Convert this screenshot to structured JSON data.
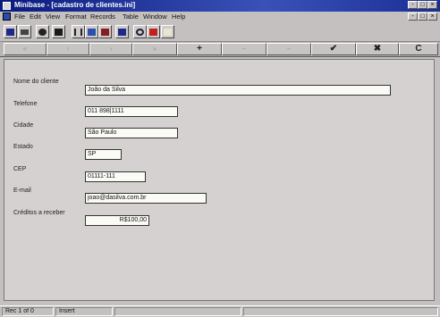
{
  "window": {
    "title": "Minibase - [cadastro de clientes.ini]",
    "controls": [
      "-",
      "□",
      "×"
    ]
  },
  "menu": [
    "File",
    "Edit",
    "View",
    "Format",
    "Records",
    "Table",
    "Window",
    "Help"
  ],
  "toolbar_icons": [
    "save-icon",
    "print-icon",
    "preview-icon",
    "table-icon",
    "cut-icon",
    "copy-icon",
    "paste-icon",
    "form-icon",
    "find-icon",
    "sort-icon",
    "blank-icon"
  ],
  "nav": {
    "first": "«",
    "prev": "‹",
    "next": "›",
    "last": "»",
    "add": "+",
    "delete": "−",
    "edit": "–",
    "save": "✔",
    "cancel": "✖",
    "refresh": "C"
  },
  "form": {
    "nome": {
      "label": "Nome do cliente",
      "value": "João da Silva"
    },
    "telefone": {
      "label": "Telefone",
      "value": "011 898|1111"
    },
    "cidade": {
      "label": "Cidade",
      "value": "São Paulo"
    },
    "estado": {
      "label": "Estado",
      "value": "SP"
    },
    "cep": {
      "label": "CEP",
      "value": "01111-111"
    },
    "email": {
      "label": "E-mail",
      "value": "joao@dasilva.com.br"
    },
    "creditos": {
      "label": "Créditos a receber",
      "value": "R$100,00"
    }
  },
  "status": {
    "record": "Rec 1 of 0",
    "mode": "Insert"
  }
}
